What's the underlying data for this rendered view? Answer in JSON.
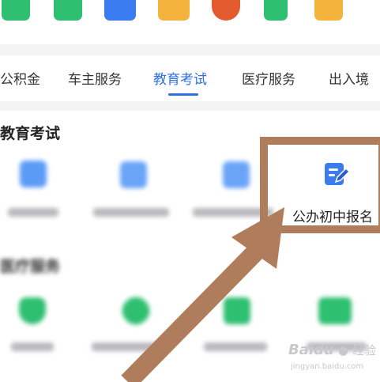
{
  "tabs": [
    "公积金",
    "车主服务",
    "教育考试",
    "医疗服务",
    "出入境"
  ],
  "active_tab": "教育考试",
  "sections": [
    {
      "title": "教育考试"
    },
    {
      "title": "医疗服务"
    }
  ],
  "highlighted_service": {
    "label": "公办初中报名",
    "icon": "edit-form-icon"
  },
  "annotation": {
    "color": "#b07d5c"
  },
  "watermark": {
    "brand": "Baidu",
    "brand_cn": "经验",
    "url": "jingyan.baidu.com"
  },
  "colors": {
    "accent": "#2f6fe0",
    "medical_green": "#2fbf71"
  }
}
